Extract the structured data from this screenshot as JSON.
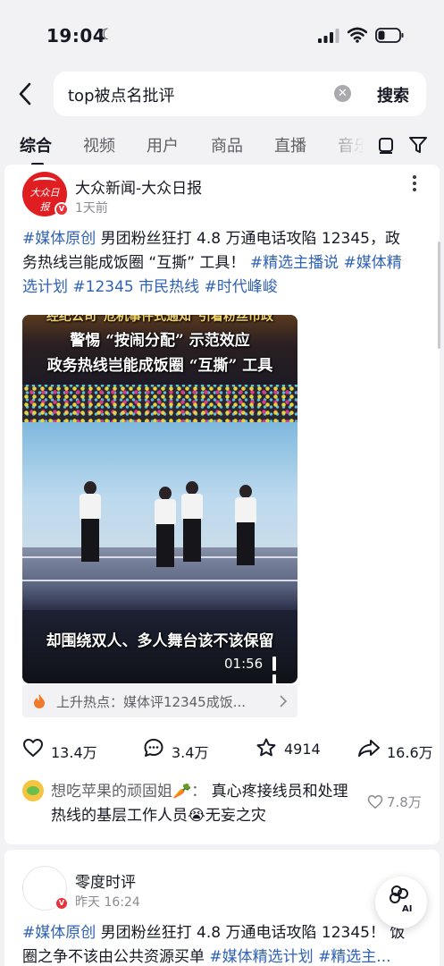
{
  "status_bar": {
    "time": "19:04"
  },
  "search": {
    "query": "top被点名批评",
    "button_label": "搜索"
  },
  "tabs": [
    {
      "label": "综合",
      "active": true
    },
    {
      "label": "视频"
    },
    {
      "label": "用户"
    },
    {
      "label": "商品"
    },
    {
      "label": "直播"
    },
    {
      "label": "音乐"
    }
  ],
  "post1": {
    "author": "大众新闻-大众日报",
    "avatar_text": "大众日报",
    "time": "1天前",
    "text_lines": [
      [
        {
          "t": "#媒体原创",
          "tag": true
        },
        {
          "t": " 男团粉丝狂打 4.8 万通电话攻陷 12345，政"
        }
      ],
      [
        {
          "t": "务热线岂能成饭圈 “互撕” 工具！ "
        },
        {
          "t": "#精选主播说",
          "tag": true
        },
        {
          "t": " "
        },
        {
          "t": "#媒体精",
          "tag": true
        }
      ],
      [
        {
          "t": "选计划",
          "tag": true
        },
        {
          "t": " "
        },
        {
          "t": "#12345 市民热线",
          "tag": true
        },
        {
          "t": " "
        },
        {
          "t": "#时代峰峻",
          "tag": true
        }
      ]
    ],
    "video": {
      "caption_top_partial": "经纪公司“危机事件式通知”引着粉丝市政",
      "caption_line1": "警惕 “按闹分配” 示范效应",
      "caption_line2": "政务热线岂能成饭圈 “互撕” 工具",
      "caption_bottom": "却围绕双人、多人舞台该不该保留",
      "duration": "01:56"
    },
    "hot_topic": "上升热点：媒体评12345成饭...",
    "stats": {
      "likes": "13.4万",
      "comments": "3.4万",
      "favorites": "4914",
      "shares": "16.6万"
    },
    "top_comment": {
      "user": "想吃苹果的顽固姐🥕：",
      "text": " 真心疼接线员和处理热线的基层工作人员😭无妄之灾",
      "likes": "7.8万"
    }
  },
  "post2": {
    "author": "零度时评",
    "time": "昨天 16:24",
    "text_lines": [
      [
        {
          "t": "#媒体原创",
          "tag": true
        },
        {
          "t": " 男团粉丝狂打 4.8 万通电话攻陷 12345！ 饭"
        }
      ],
      [
        {
          "t": "圈之争不该由公共资源买单 "
        },
        {
          "t": "#媒体精选计划",
          "tag": true
        },
        {
          "t": " "
        },
        {
          "t": "#精选主...",
          "tag": true
        }
      ]
    ]
  },
  "ai_button": {
    "label": "AI"
  },
  "colors": {
    "tag": "#2f62b5",
    "text": "#161823",
    "secondary": "#8a8b91",
    "badge_red": "#e8323c",
    "background": "#f2f2f4"
  }
}
